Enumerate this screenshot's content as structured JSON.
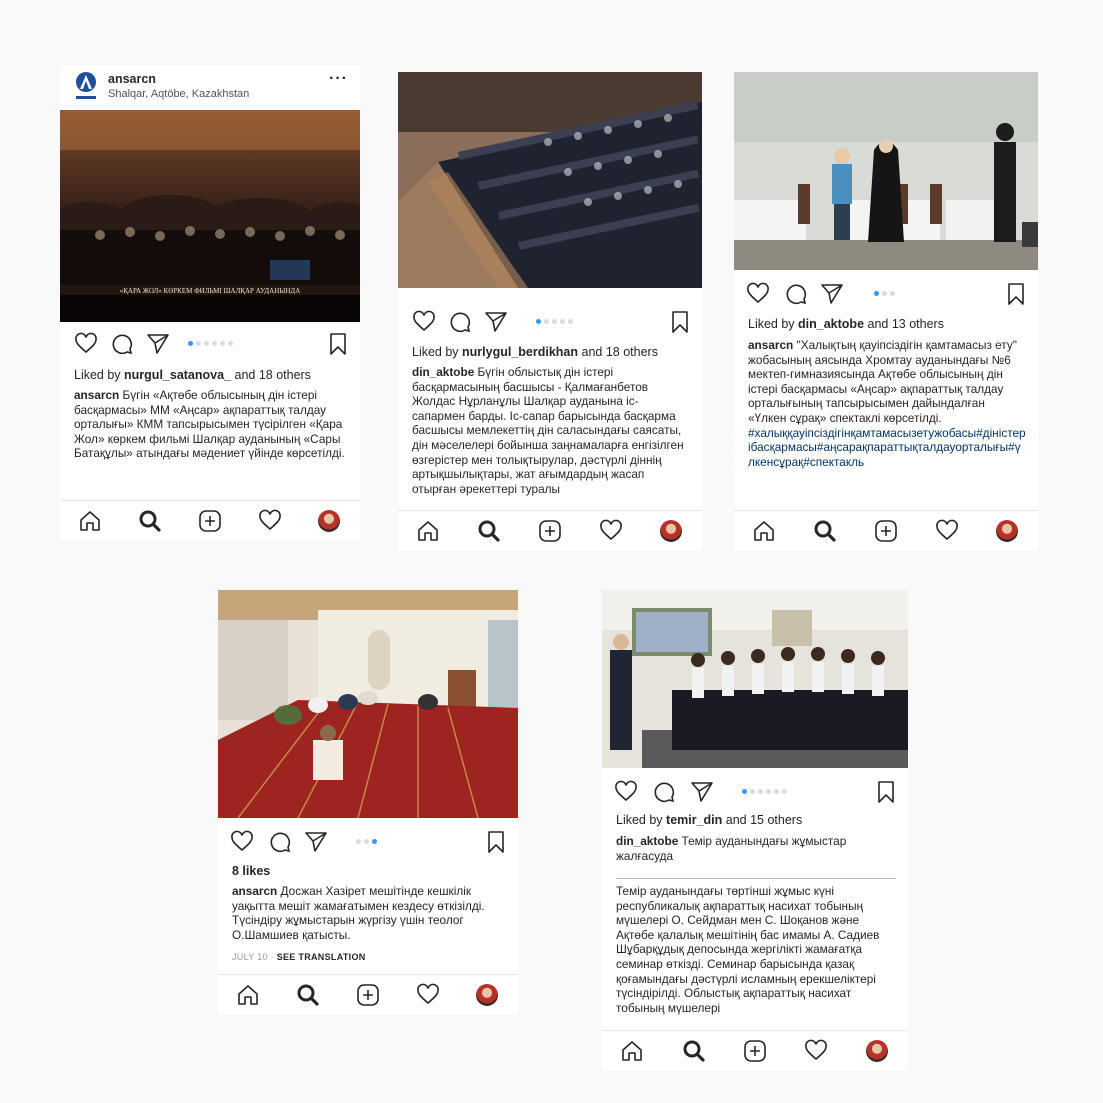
{
  "post1": {
    "username": "ansarcn",
    "location": "Shalqar, Aqtöbe, Kazakhstan",
    "more": "···",
    "photo_caption": "«ҚАРА ЖОЛ» КӨРКЕМ ФИЛЬМІ ШАЛҚАР АУДАНЫНДА",
    "liked_prefix": "Liked by ",
    "liked_user": "nurgul_satanova_",
    "liked_suffix": " and 18 others",
    "caption_user": "ansarcn",
    "caption_text": " Бүгін «Ақтөбе облысының дін істері басқармасы» ММ «Аңсар» ақпараттық талдау орталығы» КММ тапсырысымен түсірілген «Қара Жол» көркем фильмі Шалқар ауданының «Сары Батақұлы» атындағы мәдениет үйінде көрсетілді.",
    "carousel_active": 0,
    "carousel_count": 6
  },
  "post2": {
    "liked_prefix": "Liked by ",
    "liked_user": "nurlygul_berdikhan",
    "liked_suffix": " and 18 others",
    "caption_user": "din_aktobe",
    "caption_text": " Бүгін облыстық дін істері басқармасының басшысы - Қалмағанбетов Жолдас Нұрланұлы Шалқар ауданына іс-сапармен барды. Іс-сапар барысында басқарма басшысы мемлекеттің дін саласындағы саясаты, дін мәселелері бойынша заңнамаларға енгізілген өзгерістер мен толықтырулар, дәстүрлі діннің артықшылықтары, жат ағымдардың жасап отырған әрекеттері туралы",
    "carousel_active": 0,
    "carousel_count": 5
  },
  "post3": {
    "liked_prefix": "Liked by ",
    "liked_user": "din_aktobe",
    "liked_suffix": " and 13 others",
    "caption_user": "ansarcn",
    "caption_text": " \"Халықтың қауіпсіздігін қамтамасыз ету\" жобасының аясында Хромтау ауданындағы №6 мектеп-гимназиясында Ақтөбе облысының дін істері басқармасы «Аңсар» ақпараттық талдау орталығының тапсырысымен дайындалған «Үлкен сұрақ» спектаклі көрсетілді.",
    "hashtags": "#халыққауіпсіздігінқамтамасызетужобасы#діністерібасқармасы#аңсарақпараттықталдауорталығы#үлкенсұрақ#спектакль",
    "carousel_active": 0,
    "carousel_count": 3
  },
  "post4": {
    "likes": "8 likes",
    "caption_user": "ansarcn",
    "caption_text": " Досжан Хазірет мешітінде кешкілік уақытта мешіт жамағатымен кездесу өткізілді. Түсіндіру жұмыстарын жүргізу үшін теолог О.Шамшиев қатысты.",
    "date": "JULY 10",
    "see_translation": "SEE TRANSLATION",
    "carousel_active": 2,
    "carousel_count": 3
  },
  "post5": {
    "liked_prefix": "Liked by ",
    "liked_user": "temir_din",
    "liked_suffix": " and 15 others",
    "caption_user": "din_aktobe",
    "caption_text": " Темір ауданындағы жұмыстар жалғасуда",
    "body_text": "Темір ауданындағы төртінші жұмыс күні республикалық ақпараттық насихат тобының мүшелері О. Сейдман мен С. Шоқанов және Ақтөбе қалалық мешітінің бас имамы А. Садиев Шұбарқұдық депосында жергілікті жамағатқа семинар өткізді. Семинар барысында қазақ қоғамындағы дәстүрлі исламның ерекшеліктері түсіндірілді.  Облыстық ақпараттық насихат тобының мүшелері",
    "carousel_active": 0,
    "carousel_count": 6
  },
  "colors": {
    "accent": "#3897f0",
    "text": "#262626",
    "link": "#003569"
  }
}
